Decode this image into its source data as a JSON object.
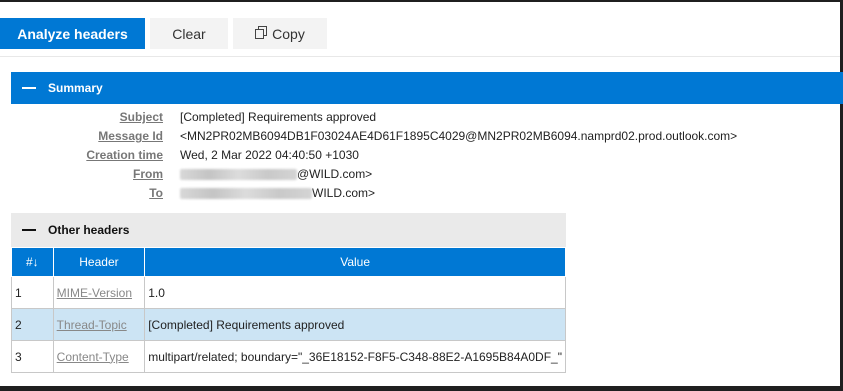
{
  "toolbar": {
    "analyze_label": "Analyze headers",
    "clear_label": "Clear",
    "copy_label": "Copy"
  },
  "summary": {
    "title": "Summary",
    "rows": [
      {
        "label": "Subject",
        "value": "[Completed] Requirements approved"
      },
      {
        "label": "Message Id",
        "value": "<MN2PR02MB6094DB1F03024AE4D61F1895C4029@MN2PR02MB6094.namprd02.prod.outlook.com>"
      },
      {
        "label": "Creation time",
        "value": "Wed, 2 Mar 2022 04:40:50 +1030"
      },
      {
        "label": "From",
        "value": "@WILD.com>"
      },
      {
        "label": "To",
        "value": "WILD.com>"
      }
    ]
  },
  "other_headers": {
    "title": "Other headers",
    "columns": [
      "#↓",
      "Header",
      "Value"
    ],
    "rows": [
      {
        "num": "1",
        "header": "MIME-Version",
        "value": "1.0"
      },
      {
        "num": "2",
        "header": "Thread-Topic",
        "value": "[Completed] Requirements approved"
      },
      {
        "num": "3",
        "header": "Content-Type",
        "value": "multipart/related; boundary=\"_36E18152-F8F5-C348-88E2-A1695B84A0DF_\""
      }
    ]
  },
  "colors": {
    "accent": "#0078d4",
    "selected_row": "#cce4f4",
    "section_gray": "#eaeaea"
  },
  "icons": [
    "collapse-icon",
    "copy-icon"
  ]
}
